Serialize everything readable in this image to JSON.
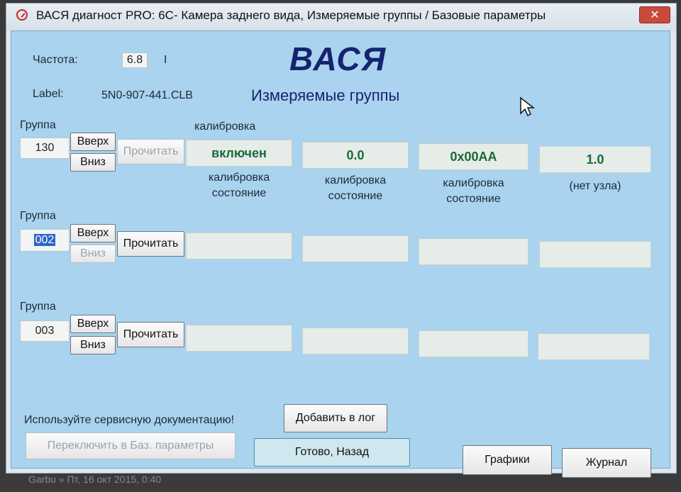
{
  "window": {
    "title": "ВАСЯ диагност PRO: 6C- Камера заднего вида,  Измеряемые группы / Базовые параметры",
    "close_label": "✕"
  },
  "header": {
    "freq_label": "Частота:",
    "freq_value": "6.8",
    "freq_extra": "I",
    "label_label": "Label:",
    "label_value": "5N0-907-441.CLB",
    "logo": "ВАСЯ",
    "section_title": "Измеряемые группы"
  },
  "groups": [
    {
      "group_label": "Группа",
      "group_value": "130",
      "up_label": "Вверх",
      "down_label": "Вниз",
      "read_label": "Прочитать",
      "title_above_cell1": "калибровка",
      "cells": [
        {
          "value": "включен",
          "caption1": "калибровка",
          "caption2": "состояние"
        },
        {
          "value": "0.0",
          "caption1": "калибровка",
          "caption2": "состояние"
        },
        {
          "value": "0x00AA",
          "caption1": "калибровка",
          "caption2": "состояние"
        },
        {
          "value": "1.0",
          "caption1": "(нет узла)",
          "caption2": ""
        }
      ]
    },
    {
      "group_label": "Группа",
      "group_value": "002",
      "up_label": "Вверх",
      "down_label": "Вниз",
      "read_label": "Прочитать"
    },
    {
      "group_label": "Группа",
      "group_value": "003",
      "up_label": "Вверх",
      "down_label": "Вниз",
      "read_label": "Прочитать"
    }
  ],
  "footer": {
    "notice": "Используйте сервисную документацию!",
    "add_log_label": "Добавить в лог",
    "switch_label": "Переключить в Баз. параметры",
    "done_label": "Готово, Назад",
    "graphs_label": "Графики",
    "journal_label": "Журнал"
  },
  "desktop_text": "Garbu » Пт, 16 окт 2015, 0:40"
}
